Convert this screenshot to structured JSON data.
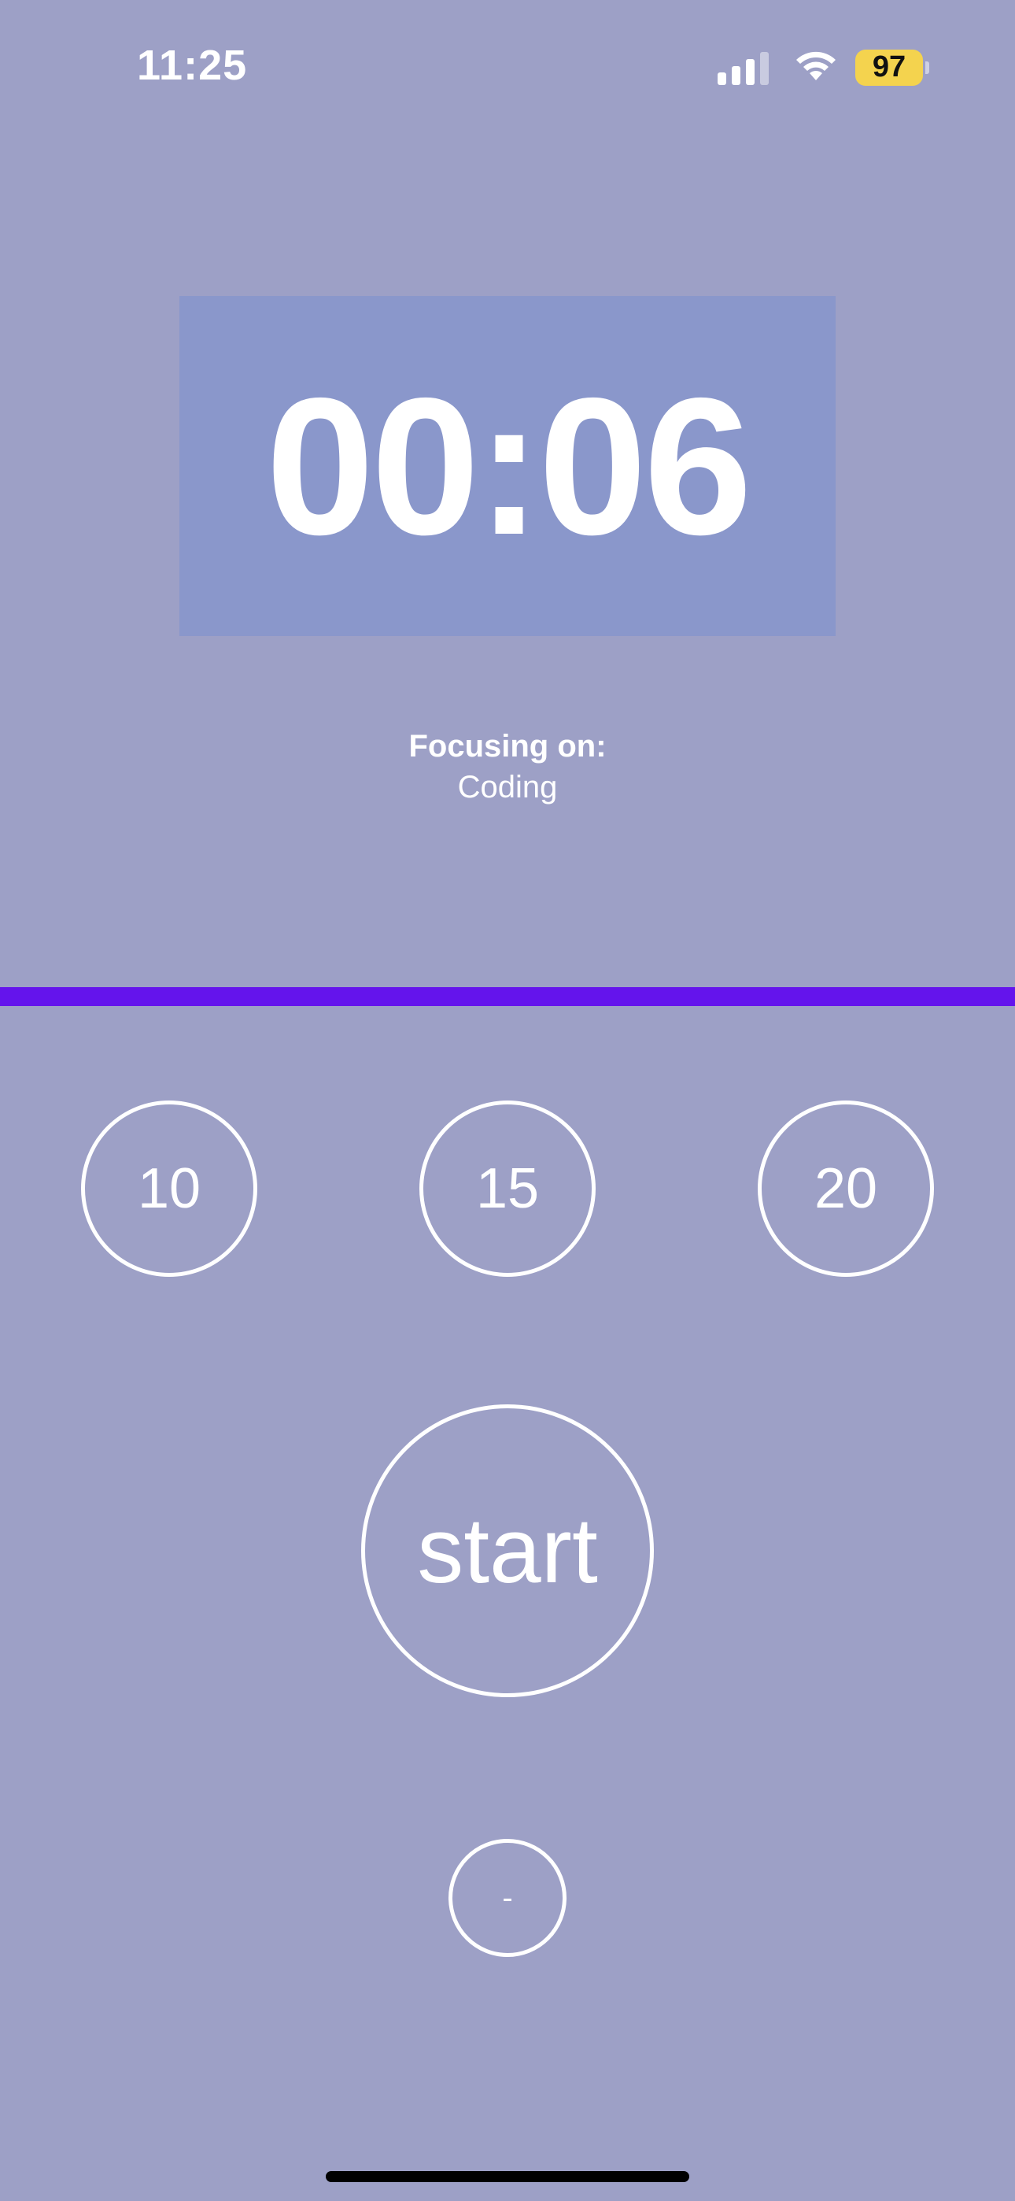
{
  "status_bar": {
    "time": "11:25",
    "battery": "97",
    "icons": [
      "cellular-signal-icon",
      "wifi-icon",
      "battery-icon"
    ]
  },
  "timer": {
    "display": "00:06"
  },
  "focus": {
    "label": "Focusing on:",
    "value": "Coding"
  },
  "presets": [
    {
      "label": "10"
    },
    {
      "label": "15"
    },
    {
      "label": "20"
    }
  ],
  "controls": {
    "start_label": "start",
    "small_button_label": "-"
  },
  "colors": {
    "background": "#9da0c6",
    "timer_box": "#8a97cb",
    "divider": "#6414ec",
    "battery": "#f4d34e"
  }
}
